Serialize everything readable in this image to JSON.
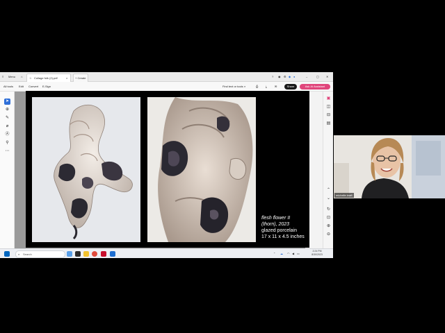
{
  "window": {
    "menu_label": "Menu",
    "tab_title": "Collage folk (2).pdf",
    "new_tab_label": "+ Create"
  },
  "toolbar": {
    "all_tools": "All tools",
    "edit": "Edit",
    "convert": "Convert",
    "esign": "E-Sign",
    "find_text": "Find text or tools",
    "share": "Share",
    "ai_assistant": "Ask AI Assistant"
  },
  "slide": {
    "caption_title": "flesh flower II",
    "caption_subtitle": "(thorn), 2023",
    "caption_material": "glazed porcelain",
    "caption_size": "17 x 11 x 4.5 inches"
  },
  "taskbar": {
    "search_placeholder": "Search",
    "time": "2:24 PM",
    "date": "8/30/2023"
  },
  "webcam": {
    "participant_name": "michelle.kraft"
  },
  "colors": {
    "share_button": "#1a1a1a",
    "ai_button": "#e0457b",
    "slide_bg": "#000000",
    "windows_blue": "#0067c0"
  }
}
